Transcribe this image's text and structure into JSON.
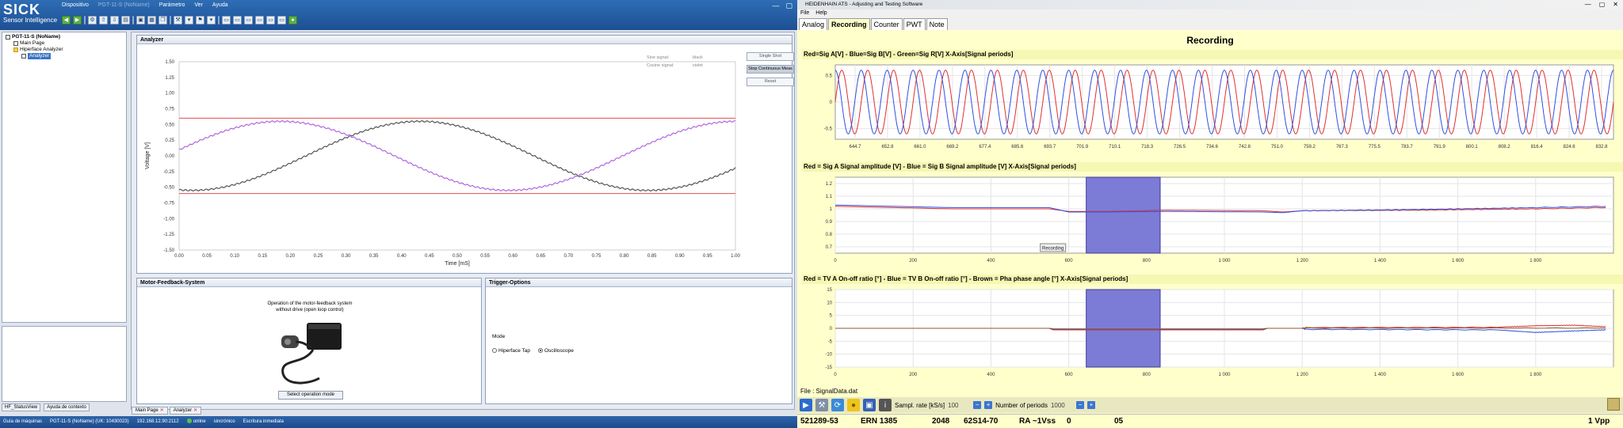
{
  "left_app": {
    "brand": "SICK",
    "tagline": "Sensor Intelligence",
    "menu": [
      {
        "label": "Dispositivo",
        "muted": false
      },
      {
        "label": "PGT-11-S (NoName)",
        "muted": true
      },
      {
        "label": "Parámetro",
        "muted": false
      },
      {
        "label": "Ver",
        "muted": false
      },
      {
        "label": "Ayuda",
        "muted": false
      }
    ],
    "tree": [
      {
        "label": "PGT-11-S (NoName)",
        "indent": 0,
        "bold": true
      },
      {
        "label": "Main Page",
        "indent": 1
      },
      {
        "label": "Hiperface Analyzer",
        "indent": 1
      },
      {
        "label": "Analyzer",
        "indent": 2,
        "selected": true
      }
    ],
    "analyzer": {
      "title": "Analyzer",
      "legend": [
        {
          "name": "Sine signal:",
          "color_name": "black"
        },
        {
          "name": "Cosine signal:",
          "color_name": "violet"
        }
      ],
      "buttons": [
        "Single Shot",
        "Stop Continuous Meas",
        "Reset"
      ]
    },
    "motor": {
      "title": "Motor-Feedback-System",
      "desc_line1": "Operation of the motor-feedback system",
      "desc_line2": "without drive (open loop control)",
      "button": "Select operation mode"
    },
    "trigger": {
      "title": "Trigger-Options",
      "mode_label": "Mode",
      "options": [
        {
          "label": "Hiperface Tap",
          "selected": false
        },
        {
          "label": "Oscilloscope",
          "selected": true
        }
      ]
    },
    "status_tabs": [
      "HF_StatusView",
      "Ayuda de contexto"
    ],
    "doc_tabs": [
      "Main Page",
      "Analyzer"
    ],
    "statusbar": [
      "Guía de máquinas",
      "PGT-11-S (NoName) (UK: 10430023)",
      "192.168.12.90:2112",
      "online",
      "sincrónico",
      "Escritura inmediata"
    ],
    "chart_data": {
      "type": "line",
      "xlabel": "Time [mS]",
      "ylabel": "Voltage [V]",
      "xlim": [
        0,
        1.0
      ],
      "ylim": [
        -1.5,
        1.5
      ],
      "x_ticks": [
        "0.00",
        "0.05",
        "0.10",
        "0.15",
        "0.20",
        "0.25",
        "0.30",
        "0.35",
        "0.40",
        "0.45",
        "0.50",
        "0.55",
        "0.60",
        "0.65",
        "0.70",
        "0.75",
        "0.80",
        "0.85",
        "0.90",
        "0.95",
        "1.00"
      ],
      "y_ticks": [
        "1.50",
        "1.25",
        "1.00",
        "0.75",
        "0.50",
        "0.25",
        "0.00",
        "-0.25",
        "-0.50",
        "-0.75",
        "-1.00",
        "-1.25",
        "-1.50"
      ],
      "threshold_lines": [
        0.6,
        -0.6
      ],
      "series": [
        {
          "name": "Sine signal:",
          "color": "#555555",
          "amplitude": 0.55,
          "period_ms": 0.82,
          "phase_deg": -100
        },
        {
          "name": "Cosine signal:",
          "color": "#b366e0",
          "amplitude": 0.55,
          "period_ms": 0.82,
          "phase_deg": 10
        }
      ]
    }
  },
  "right_app": {
    "title": "HEIDENHAIN ATS - Adjusting and Testing Software",
    "menu": [
      "File",
      "Help"
    ],
    "tabs": [
      {
        "label": "Analog",
        "active": false
      },
      {
        "label": "Recording",
        "active": true
      },
      {
        "label": "Counter",
        "active": false
      },
      {
        "label": "PWT",
        "active": false
      },
      {
        "label": "Note",
        "active": false
      }
    ],
    "heading": "Recording",
    "file_label": "File : SignalData.dat",
    "sampl_label": "Sampl. rate [kS/s]",
    "sampl_value": "100",
    "periods_label": "Number of periods",
    "periods_value": "1000",
    "status": {
      "id": "521289-53",
      "model": "ERN 1385",
      "lines": "2048",
      "code": "62S14-70",
      "ra": "RA ~1Vss",
      "v1": "0",
      "v2": "05",
      "vpp": "1 Vpp"
    },
    "charts": [
      {
        "type": "line",
        "label": "Red=Sig A[V] - Blue=Sig B[V] - Green=Sig R[V]   X-Axis[Signal periods]",
        "ylim": [
          -0.7,
          0.7
        ],
        "y_ticks": [
          "0.5",
          "0",
          "-0.5"
        ],
        "x_ticks": [
          "644.7",
          "652.8",
          "661.0",
          "669.2",
          "677.4",
          "685.6",
          "693.7",
          "701.9",
          "710.1",
          "718.3",
          "726.5",
          "734.6",
          "742.8",
          "751.0",
          "759.2",
          "767.3",
          "775.5",
          "783.7",
          "791.9",
          "800.1",
          "808.2",
          "816.4",
          "824.6",
          "832.8"
        ],
        "cycles": 30,
        "series": [
          {
            "name": "Sig A",
            "color": "#e03030",
            "amplitude": 0.6,
            "phase_deg": 0
          },
          {
            "name": "Sig B",
            "color": "#3050e0",
            "amplitude": 0.6,
            "phase_deg": 90
          }
        ]
      },
      {
        "type": "line",
        "label": "Red = Sig A Signal amplitude [V] - Blue = Sig B Signal amplitude [V]   X-Axis[Signal periods]",
        "ylim": [
          0.65,
          1.25
        ],
        "y_ticks": [
          "1.2",
          "1.1",
          "1",
          "0.9",
          "0.8",
          "0.7"
        ],
        "x_ticks": [
          "0",
          "200",
          "400",
          "600",
          "800",
          "1 000",
          "1 200",
          "1 400",
          "1 600",
          "1 800"
        ],
        "xlim": [
          0,
          2000
        ],
        "highlight": [
          645,
          835
        ],
        "annotation": "Recording",
        "series": [
          {
            "name": "Sig A amplitude",
            "color": "#e03030",
            "points": [
              [
                0,
                1.02
              ],
              [
                300,
                1.0
              ],
              [
                550,
                1.0
              ],
              [
                600,
                0.98
              ],
              [
                700,
                0.98
              ],
              [
                850,
                0.99
              ],
              [
                1100,
                0.985
              ],
              [
                1150,
                0.975
              ],
              [
                1200,
                0.985
              ],
              [
                1500,
                0.99
              ],
              [
                1800,
                1.0
              ],
              [
                1980,
                1.01
              ]
            ]
          },
          {
            "name": "Sig B amplitude",
            "color": "#3050e0",
            "points": [
              [
                0,
                1.03
              ],
              [
                300,
                1.01
              ],
              [
                550,
                1.01
              ],
              [
                600,
                0.975
              ],
              [
                700,
                0.975
              ],
              [
                850,
                0.98
              ],
              [
                1100,
                0.975
              ],
              [
                1150,
                0.97
              ],
              [
                1200,
                0.985
              ],
              [
                1500,
                0.995
              ],
              [
                1800,
                1.01
              ],
              [
                1980,
                1.02
              ]
            ]
          }
        ]
      },
      {
        "type": "line",
        "label": "Red = TV A On-off ratio [°] - Blue = TV B On-off ratio [°] - Brown = Pha phase angle [°]   X-Axis[Signal periods]",
        "ylim": [
          -15,
          15
        ],
        "y_ticks": [
          "15",
          "10",
          "5",
          "0",
          "-5",
          "-10",
          "-15"
        ],
        "x_ticks": [
          "0",
          "200",
          "400",
          "600",
          "800",
          "1 000",
          "1 200",
          "1 400",
          "1 600",
          "1 800"
        ],
        "xlim": [
          0,
          2000
        ],
        "highlight": [
          645,
          835
        ],
        "series": [
          {
            "name": "TV A",
            "color": "#e03030",
            "points": [
              [
                0,
                0
              ],
              [
                550,
                0
              ],
              [
                560,
                -0.6
              ],
              [
                1100,
                -0.6
              ],
              [
                1110,
                0
              ],
              [
                1200,
                0
              ],
              [
                1210,
                0.3
              ],
              [
                1700,
                0.4
              ],
              [
                1800,
                1.0
              ],
              [
                1900,
                1.2
              ],
              [
                1980,
                0.6
              ]
            ]
          },
          {
            "name": "TV B",
            "color": "#3050e0",
            "points": [
              [
                0,
                0
              ],
              [
                550,
                0
              ],
              [
                560,
                -0.4
              ],
              [
                1100,
                -0.4
              ],
              [
                1110,
                0
              ],
              [
                1200,
                0
              ],
              [
                1210,
                -0.4
              ],
              [
                1700,
                -0.6
              ],
              [
                1800,
                -1.6
              ],
              [
                1900,
                -1.0
              ],
              [
                1980,
                -0.6
              ]
            ]
          },
          {
            "name": "Pha",
            "color": "#8b5a2b",
            "points": [
              [
                0,
                0
              ],
              [
                550,
                0
              ],
              [
                560,
                -0.2
              ],
              [
                1100,
                -0.2
              ],
              [
                1110,
                0
              ],
              [
                1200,
                0
              ],
              [
                1210,
                0.1
              ],
              [
                1980,
                0.1
              ]
            ]
          }
        ]
      }
    ]
  }
}
